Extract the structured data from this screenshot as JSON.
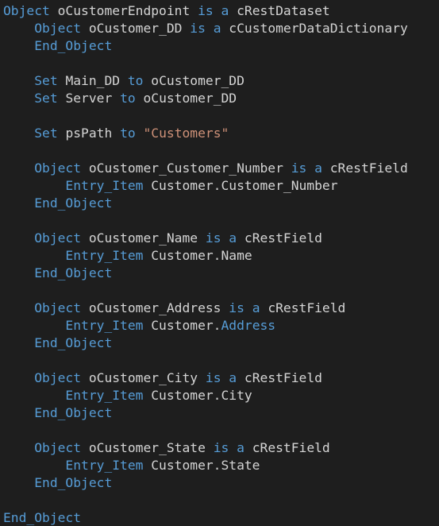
{
  "code_lines": [
    {
      "indent": 0,
      "tokens": [
        {
          "t": "Object",
          "c": "kw"
        },
        {
          "t": " oCustomerEndpoint ",
          "c": "id"
        },
        {
          "t": "is a",
          "c": "kw"
        },
        {
          "t": " cRestDataset",
          "c": "id"
        }
      ]
    },
    {
      "indent": 1,
      "tokens": [
        {
          "t": "Object",
          "c": "kw"
        },
        {
          "t": " oCustomer_DD ",
          "c": "id"
        },
        {
          "t": "is a",
          "c": "kw"
        },
        {
          "t": " cCustomerDataDictionary",
          "c": "id"
        }
      ]
    },
    {
      "indent": 1,
      "tokens": [
        {
          "t": "End_Object",
          "c": "kw"
        }
      ]
    },
    {
      "indent": 0,
      "tokens": []
    },
    {
      "indent": 1,
      "tokens": [
        {
          "t": "Set",
          "c": "kw"
        },
        {
          "t": " Main_DD ",
          "c": "id"
        },
        {
          "t": "to",
          "c": "kw"
        },
        {
          "t": " oCustomer_DD",
          "c": "id"
        }
      ]
    },
    {
      "indent": 1,
      "tokens": [
        {
          "t": "Set",
          "c": "kw"
        },
        {
          "t": " Server ",
          "c": "id"
        },
        {
          "t": "to",
          "c": "kw"
        },
        {
          "t": " oCustomer_DD",
          "c": "id"
        }
      ]
    },
    {
      "indent": 0,
      "tokens": []
    },
    {
      "indent": 1,
      "tokens": [
        {
          "t": "Set",
          "c": "kw"
        },
        {
          "t": " psPath ",
          "c": "id"
        },
        {
          "t": "to",
          "c": "kw"
        },
        {
          "t": " ",
          "c": "id"
        },
        {
          "t": "\"Customers\"",
          "c": "str"
        }
      ]
    },
    {
      "indent": 0,
      "tokens": []
    },
    {
      "indent": 1,
      "tokens": [
        {
          "t": "Object",
          "c": "kw"
        },
        {
          "t": " oCustomer_Customer_Number ",
          "c": "id"
        },
        {
          "t": "is a",
          "c": "kw"
        },
        {
          "t": " cRestField",
          "c": "id"
        }
      ]
    },
    {
      "indent": 2,
      "tokens": [
        {
          "t": "Entry_Item",
          "c": "kw"
        },
        {
          "t": " Customer.Customer_Number",
          "c": "id"
        }
      ]
    },
    {
      "indent": 1,
      "tokens": [
        {
          "t": "End_Object",
          "c": "kw"
        }
      ]
    },
    {
      "indent": 0,
      "tokens": []
    },
    {
      "indent": 1,
      "tokens": [
        {
          "t": "Object",
          "c": "kw"
        },
        {
          "t": " oCustomer_Name ",
          "c": "id"
        },
        {
          "t": "is a",
          "c": "kw"
        },
        {
          "t": " cRestField",
          "c": "id"
        }
      ]
    },
    {
      "indent": 2,
      "tokens": [
        {
          "t": "Entry_Item",
          "c": "kw"
        },
        {
          "t": " Customer.Name",
          "c": "id"
        }
      ]
    },
    {
      "indent": 1,
      "tokens": [
        {
          "t": "End_Object",
          "c": "kw"
        }
      ]
    },
    {
      "indent": 0,
      "tokens": []
    },
    {
      "indent": 1,
      "tokens": [
        {
          "t": "Object",
          "c": "kw"
        },
        {
          "t": " oCustomer_Address ",
          "c": "id"
        },
        {
          "t": "is a",
          "c": "kw"
        },
        {
          "t": " cRestField",
          "c": "id"
        }
      ]
    },
    {
      "indent": 2,
      "tokens": [
        {
          "t": "Entry_Item",
          "c": "kw"
        },
        {
          "t": " Customer.",
          "c": "id"
        },
        {
          "t": "Address",
          "c": "kw"
        }
      ]
    },
    {
      "indent": 1,
      "tokens": [
        {
          "t": "End_Object",
          "c": "kw"
        }
      ]
    },
    {
      "indent": 0,
      "tokens": []
    },
    {
      "indent": 1,
      "tokens": [
        {
          "t": "Object",
          "c": "kw"
        },
        {
          "t": " oCustomer_City ",
          "c": "id"
        },
        {
          "t": "is a",
          "c": "kw"
        },
        {
          "t": " cRestField",
          "c": "id"
        }
      ]
    },
    {
      "indent": 2,
      "tokens": [
        {
          "t": "Entry_Item",
          "c": "kw"
        },
        {
          "t": " Customer.City",
          "c": "id"
        }
      ]
    },
    {
      "indent": 1,
      "tokens": [
        {
          "t": "End_Object",
          "c": "kw"
        }
      ]
    },
    {
      "indent": 0,
      "tokens": []
    },
    {
      "indent": 1,
      "tokens": [
        {
          "t": "Object",
          "c": "kw"
        },
        {
          "t": " oCustomer_State ",
          "c": "id"
        },
        {
          "t": "is a",
          "c": "kw"
        },
        {
          "t": " cRestField",
          "c": "id"
        }
      ]
    },
    {
      "indent": 2,
      "tokens": [
        {
          "t": "Entry_Item",
          "c": "kw"
        },
        {
          "t": " Customer.State",
          "c": "id"
        }
      ]
    },
    {
      "indent": 1,
      "tokens": [
        {
          "t": "End_Object",
          "c": "kw"
        }
      ]
    },
    {
      "indent": 0,
      "tokens": []
    },
    {
      "indent": 0,
      "tokens": [
        {
          "t": "End_Object",
          "c": "kw"
        }
      ]
    }
  ],
  "colors": {
    "background": "#1e1e1e",
    "keyword": "#569cd6",
    "identifier": "#d4d4d4",
    "string": "#ce9178"
  }
}
